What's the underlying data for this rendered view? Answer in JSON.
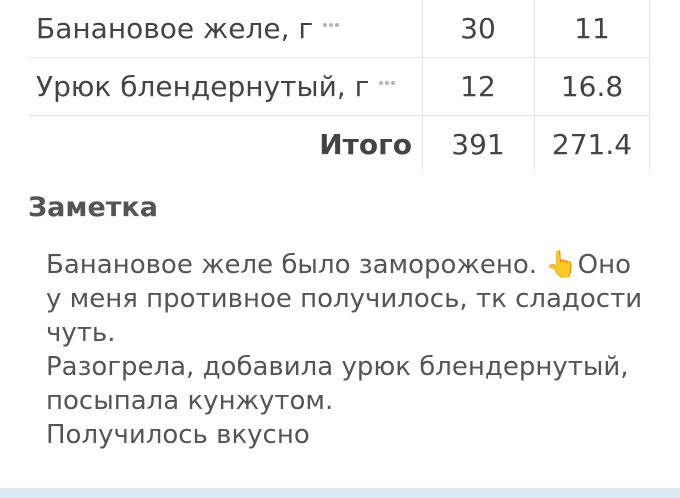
{
  "table": {
    "rows": [
      {
        "name": "Банановое желе, г",
        "col1": "30",
        "col2": "11"
      },
      {
        "name": "Урюк блендернутый, г",
        "col1": "12",
        "col2": "16.8"
      }
    ],
    "total": {
      "label": "Итого",
      "col1": "391",
      "col2": "271.4"
    },
    "more_icon": "more-dots-icon"
  },
  "note": {
    "title": "Заметка",
    "text": "Банановое желе было заморожено. 👆Оно\nу меня противное получилось, тк сладости\nчуть.\nРазогрела, добавила урюк блендернутый,\nпосыпала кунжутом.\nПолучилось вкусно"
  },
  "colors": {
    "text": "#444444",
    "border": "#e3e3e3",
    "bottom_bar": "#dbe9f1"
  }
}
